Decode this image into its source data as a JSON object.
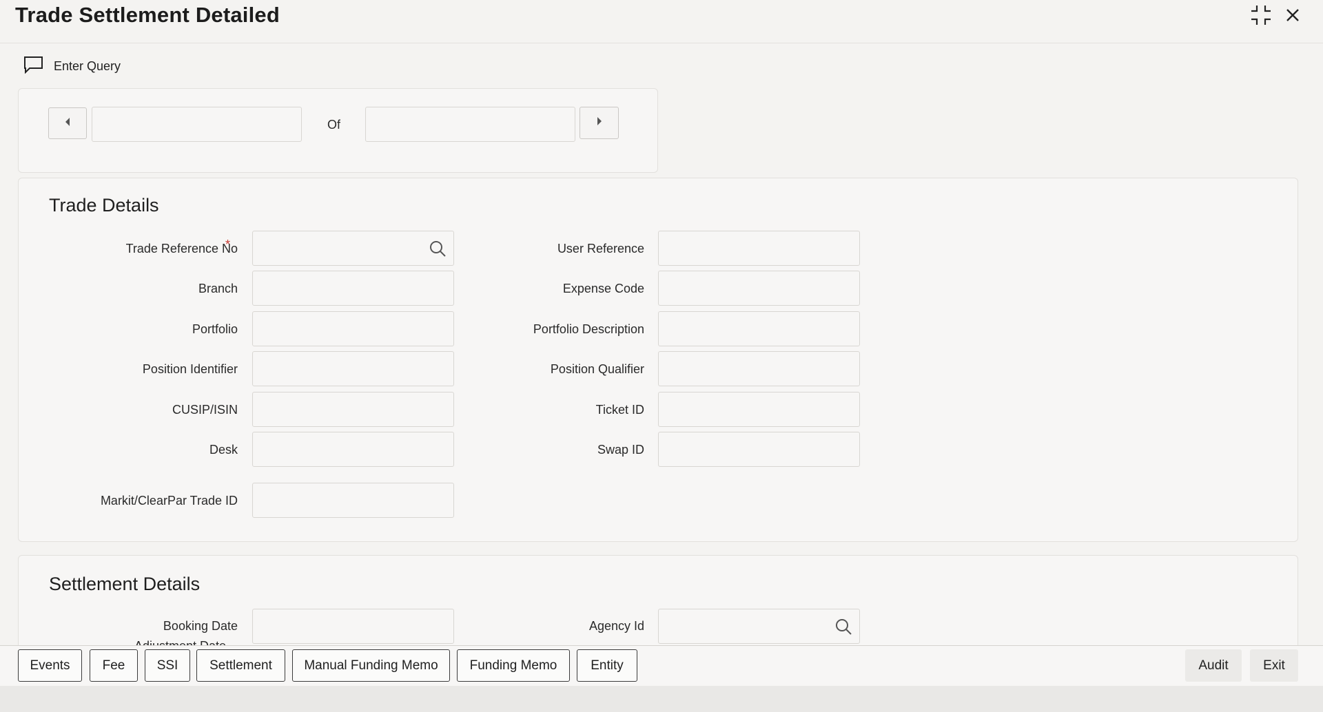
{
  "window": {
    "title": "Trade Settlement Detailed"
  },
  "toolbar": {
    "enter_query_label": "Enter Query"
  },
  "pager": {
    "of_label": "Of",
    "current_value": "",
    "total_value": ""
  },
  "trade_details": {
    "title": "Trade Details",
    "fields": {
      "trade_reference_no": {
        "label": "Trade Reference No",
        "required_mark": "*",
        "value": ""
      },
      "branch": {
        "label": "Branch",
        "value": ""
      },
      "portfolio": {
        "label": "Portfolio",
        "value": ""
      },
      "position_identifier": {
        "label": "Position Identifier",
        "value": ""
      },
      "cusip_isin": {
        "label": "CUSIP/ISIN",
        "value": ""
      },
      "desk": {
        "label": "Desk",
        "value": ""
      },
      "markit_clearpar_trade_id": {
        "label": "Markit/ClearPar Trade ID",
        "value": ""
      },
      "user_reference": {
        "label": "User Reference",
        "value": ""
      },
      "expense_code": {
        "label": "Expense Code",
        "value": ""
      },
      "portfolio_description": {
        "label": "Portfolio Description",
        "value": ""
      },
      "position_qualifier": {
        "label": "Position Qualifier",
        "value": ""
      },
      "ticket_id": {
        "label": "Ticket ID",
        "value": ""
      },
      "swap_id": {
        "label": "Swap ID",
        "value": ""
      }
    }
  },
  "settlement_details": {
    "title": "Settlement Details",
    "fields": {
      "booking_date": {
        "label": "Booking Date",
        "value": ""
      },
      "agency_id": {
        "label": "Agency Id",
        "value": ""
      },
      "adjustment_date_partial": {
        "label": "Adjustment Date"
      }
    }
  },
  "bottom_buttons": {
    "events": "Events",
    "fee": "Fee",
    "ssi": "SSI",
    "settlement": "Settlement",
    "manual_funding_memo": "Manual Funding Memo",
    "funding_memo": "Funding Memo",
    "entity": "Entity",
    "audit": "Audit",
    "exit": "Exit"
  },
  "colors": {
    "required": "#c7372f",
    "background": "#f4f3f1",
    "panel": "#f7f6f5"
  }
}
